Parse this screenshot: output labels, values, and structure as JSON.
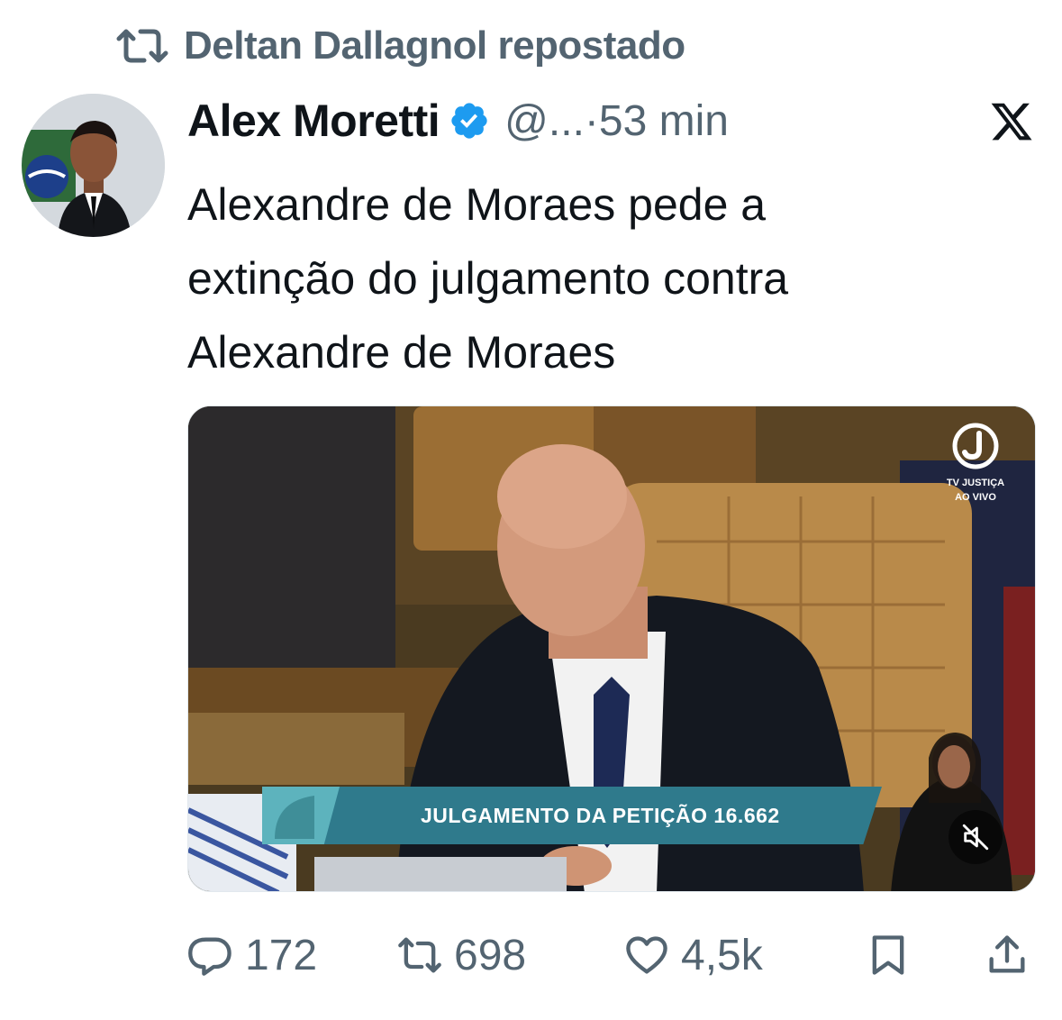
{
  "repost": {
    "icon": "repost-icon",
    "text": "Deltan Dallagnol repostado"
  },
  "tweet": {
    "author_name": "Alex Moretti",
    "verified_icon": "verified-badge-icon",
    "handle_and_time": "@...·53 min",
    "text_lines": [
      "Alexandre de Moraes pede a",
      "extinção do julgamento contra",
      "Alexandre de Moraes"
    ]
  },
  "media": {
    "broadcaster": {
      "label_line1": "TV JUSTIÇA",
      "label_line2": "AO VIVO"
    },
    "lower_third": "JULGAMENTO DA PETIÇÃO 16.662",
    "mute_icon": "mute-icon"
  },
  "actions": {
    "replies": "172",
    "reposts": "698",
    "likes": "4,5k"
  },
  "colors": {
    "text_primary": "#0f1419",
    "text_secondary": "#536471",
    "verified_blue": "#1d9bf0",
    "lower_third_bar": "#2f7a8c"
  }
}
